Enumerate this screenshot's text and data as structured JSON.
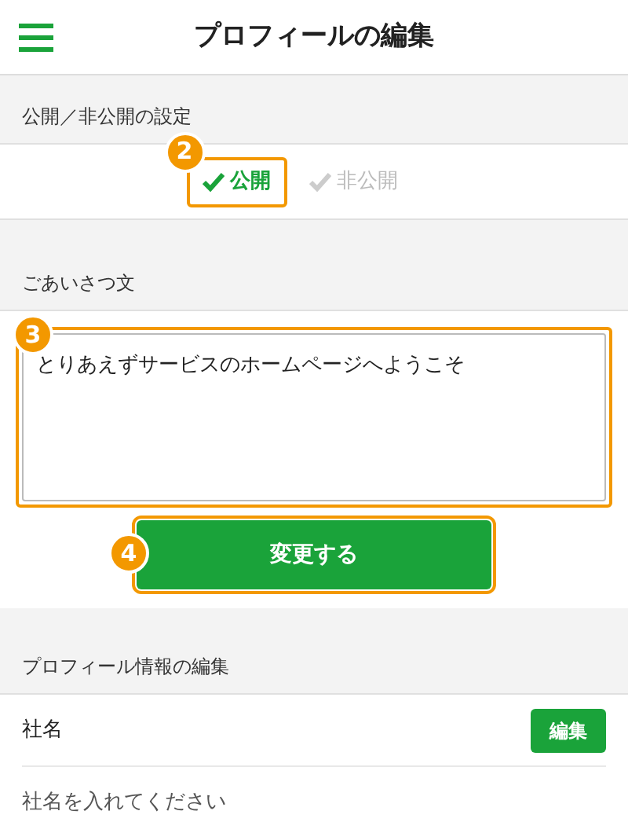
{
  "header": {
    "title": "プロフィールの編集"
  },
  "visibility": {
    "heading": "公開／非公開の設定",
    "options": [
      {
        "label": "公開",
        "selected": true,
        "callout": "2"
      },
      {
        "label": "非公開",
        "selected": false
      }
    ]
  },
  "greeting": {
    "heading": "ごあいさつ文",
    "value": "とりあえずサービスのホームページへようこそ",
    "callout": "3"
  },
  "submit": {
    "label": "変更する",
    "callout": "4"
  },
  "profile": {
    "heading": "プロフィール情報の編集",
    "fields": [
      {
        "label": "社名",
        "button": "編集",
        "placeholder": "社名を入れてください"
      }
    ]
  }
}
